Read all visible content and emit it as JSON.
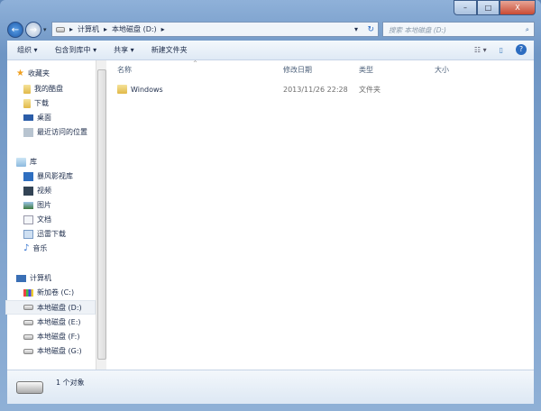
{
  "window": {
    "minimize": "–",
    "maximize": "□",
    "close": "X"
  },
  "address": {
    "crumbs": [
      "计算机",
      "本地磁盘 (D:)"
    ],
    "search_placeholder": "搜索 本地磁盘 (D:)"
  },
  "toolbar": {
    "organize": "组织 ▾",
    "include": "包含到库中 ▾",
    "share": "共享 ▾",
    "new_folder": "新建文件夹",
    "view": "☷ ▾",
    "preview": "▯",
    "help": "?"
  },
  "sidebar": {
    "favorites": {
      "label": "收藏夹",
      "items": [
        "我的酷盘",
        "下载",
        "桌面",
        "最近访问的位置"
      ]
    },
    "libraries": {
      "label": "库",
      "items": [
        "暴风影视库",
        "视频",
        "图片",
        "文档",
        "迅雷下载",
        "音乐"
      ]
    },
    "computer": {
      "label": "计算机",
      "items": [
        "新加卷 (C:)",
        "本地磁盘 (D:)",
        "本地磁盘 (E:)",
        "本地磁盘 (F:)",
        "本地磁盘 (G:)"
      ]
    }
  },
  "columns": [
    "名称",
    "修改日期",
    "类型",
    "大小"
  ],
  "files": [
    {
      "name": "Windows",
      "date": "2013/11/26 22:28",
      "type": "文件夹",
      "size": ""
    }
  ],
  "status": {
    "count": "1 个对象"
  }
}
